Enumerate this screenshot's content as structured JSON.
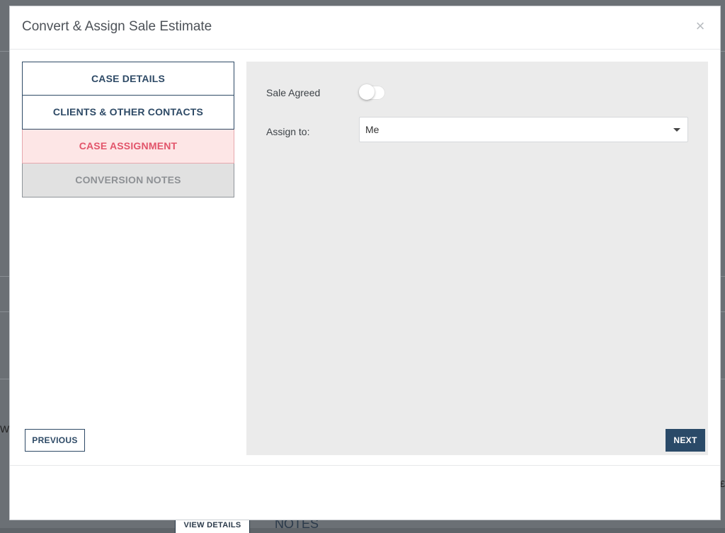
{
  "modal": {
    "title": "Convert & Assign Sale Estimate",
    "close_symbol": "×"
  },
  "steps": [
    {
      "label": "CASE DETAILS",
      "state": "default"
    },
    {
      "label": "CLIENTS & OTHER CONTACTS",
      "state": "default"
    },
    {
      "label": "CASE ASSIGNMENT",
      "state": "active"
    },
    {
      "label": "CONVERSION NOTES",
      "state": "disabled"
    }
  ],
  "form": {
    "sale_agreed_label": "Sale Agreed",
    "sale_agreed_value": false,
    "assign_to_label": "Assign to:",
    "assign_to_value": "Me"
  },
  "footer": {
    "previous_label": "PREVIOUS",
    "next_label": "NEXT"
  },
  "background": {
    "view_details_label": "VIEW DETAILS",
    "notes_heading": "NOTES",
    "left_fragment": "W",
    "right_fragment": "£"
  },
  "colors": {
    "primary": "#2a4a68",
    "active_step_text": "#e2546a",
    "active_step_bg": "#fde6e6",
    "disabled_step_bg": "#e1e1e1",
    "panel_bg": "#ebebeb"
  }
}
